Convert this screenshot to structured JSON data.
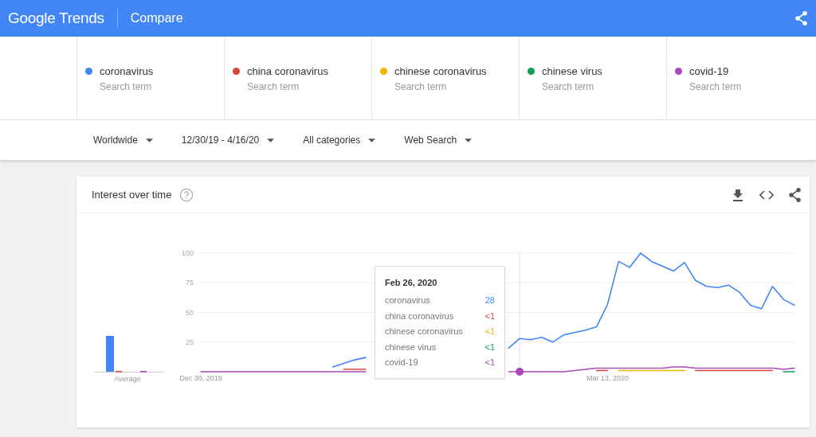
{
  "header": {
    "logo": "Google Trends",
    "title": "Compare"
  },
  "terms": [
    {
      "name": "coronavirus",
      "subtitle": "Search term",
      "color": "#4285f4"
    },
    {
      "name": "china coronavirus",
      "subtitle": "Search term",
      "color": "#db4437"
    },
    {
      "name": "chinese coronavirus",
      "subtitle": "Search term",
      "color": "#f4b400"
    },
    {
      "name": "chinese virus",
      "subtitle": "Search term",
      "color": "#0f9d58"
    },
    {
      "name": "covid-19",
      "subtitle": "Search term",
      "color": "#ab47bc"
    }
  ],
  "filters": [
    "Worldwide",
    "12/30/19 - 4/16/20",
    "All categories",
    "Web Search"
  ],
  "card": {
    "title": "Interest over time",
    "average_label": "Average",
    "chart_data": {
      "type": "line",
      "categories": [
        "Dec 30, 2019",
        null,
        null,
        null,
        null,
        null,
        null,
        null,
        null,
        null,
        null,
        null,
        null,
        null,
        null,
        null,
        null,
        null,
        null,
        null,
        null,
        null,
        null,
        null,
        null,
        null,
        null,
        null,
        null,
        null,
        null,
        null,
        null,
        null,
        null,
        null,
        null,
        "Mar 13, 2020",
        null,
        null,
        null,
        null,
        null,
        null,
        null,
        null,
        null,
        null,
        null,
        null,
        null,
        null,
        null,
        null,
        null
      ],
      "ylim": [
        0,
        100
      ],
      "yticks": [
        25,
        50,
        75,
        100
      ],
      "grid": true,
      "series": [
        {
          "name": "coronavirus",
          "color": "#4285f4",
          "values": [
            null,
            null,
            null,
            null,
            null,
            null,
            null,
            null,
            null,
            null,
            null,
            null,
            4,
            7,
            10,
            12,
            null,
            null,
            null,
            null,
            null,
            null,
            null,
            null,
            null,
            null,
            null,
            null,
            20,
            28,
            27,
            29,
            25,
            31,
            33,
            35,
            38,
            57,
            93,
            88,
            100,
            93,
            89,
            85,
            92,
            77,
            72,
            71,
            73,
            67,
            56,
            53,
            72,
            61,
            56
          ]
        },
        {
          "name": "china coronavirus",
          "color": "#db4437",
          "values": [
            null,
            null,
            null,
            null,
            null,
            null,
            null,
            null,
            null,
            null,
            null,
            null,
            null,
            2,
            2,
            2,
            null,
            null,
            null,
            null,
            null,
            null,
            null,
            null,
            null,
            null,
            null,
            null,
            null,
            null,
            null,
            null,
            null,
            null,
            null,
            null,
            1,
            1,
            null,
            null,
            null,
            null,
            null,
            null,
            null,
            1,
            1,
            1,
            1,
            1,
            1,
            1,
            1,
            null,
            null
          ]
        },
        {
          "name": "chinese coronavirus",
          "color": "#f4b400",
          "values": [
            null,
            null,
            null,
            null,
            null,
            null,
            null,
            null,
            null,
            null,
            null,
            null,
            null,
            null,
            null,
            null,
            null,
            null,
            null,
            null,
            null,
            null,
            null,
            null,
            null,
            null,
            null,
            null,
            null,
            null,
            null,
            null,
            null,
            null,
            null,
            null,
            null,
            null,
            1,
            1,
            1,
            1,
            1,
            1,
            1,
            null,
            null,
            null,
            null,
            null,
            null,
            null,
            null,
            null,
            null
          ]
        },
        {
          "name": "chinese virus",
          "color": "#0f9d58",
          "values": [
            null,
            null,
            null,
            null,
            null,
            null,
            null,
            null,
            null,
            null,
            null,
            null,
            null,
            null,
            null,
            null,
            null,
            null,
            null,
            null,
            null,
            null,
            null,
            null,
            null,
            null,
            null,
            null,
            null,
            null,
            null,
            null,
            null,
            null,
            null,
            null,
            null,
            null,
            null,
            null,
            null,
            null,
            null,
            null,
            null,
            null,
            null,
            null,
            null,
            null,
            null,
            null,
            null,
            0,
            0
          ]
        },
        {
          "name": "covid-19",
          "color": "#ab47bc",
          "values": [
            0,
            0,
            0,
            0,
            0,
            0,
            0,
            0,
            0,
            0,
            0,
            0,
            0,
            0,
            0,
            0,
            null,
            null,
            null,
            null,
            null,
            null,
            null,
            null,
            null,
            null,
            null,
            null,
            0,
            0,
            0,
            0,
            0,
            0,
            1,
            2,
            3,
            3,
            3,
            3,
            3,
            3,
            3,
            4,
            4,
            3,
            3,
            3,
            3,
            3,
            3,
            3,
            3,
            2,
            3
          ]
        }
      ]
    },
    "tooltip": {
      "date": "Feb 26, 2020",
      "values": [
        "28",
        "<1",
        "<1",
        "<1",
        "<1"
      ]
    }
  }
}
